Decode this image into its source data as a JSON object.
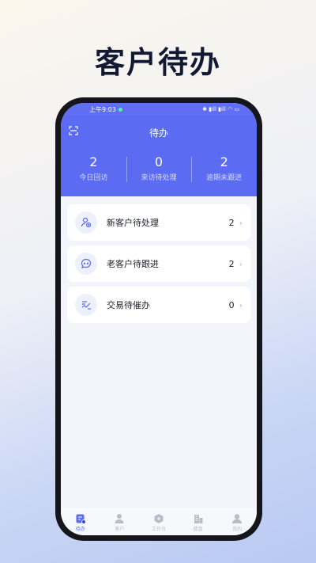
{
  "promo": {
    "headline": "客户待办"
  },
  "status_bar": {
    "time": "上午9:03",
    "indicators": "✱ ▮ill ▮ill ◠ ▭"
  },
  "header": {
    "title": "待办"
  },
  "stats": [
    {
      "value": "2",
      "label": "今日回访"
    },
    {
      "value": "0",
      "label": "来访待处理"
    },
    {
      "value": "2",
      "label": "逾期未跟进"
    }
  ],
  "tasks": [
    {
      "label": "新客户待处理",
      "count": "2",
      "icon": "user-add-icon"
    },
    {
      "label": "老客户待跟进",
      "count": "2",
      "icon": "chat-icon"
    },
    {
      "label": "交易待催办",
      "count": "0",
      "icon": "transaction-icon"
    }
  ],
  "tabs": [
    {
      "label": "待办",
      "icon": "todo-icon",
      "active": true
    },
    {
      "label": "客户",
      "icon": "customer-icon"
    },
    {
      "label": "工作台",
      "icon": "workbench-icon"
    },
    {
      "label": "楼盘",
      "icon": "building-icon"
    },
    {
      "label": "我的",
      "icon": "profile-icon"
    }
  ],
  "colors": {
    "primary": "#5b6cf2",
    "background": "#f3f5fa"
  }
}
